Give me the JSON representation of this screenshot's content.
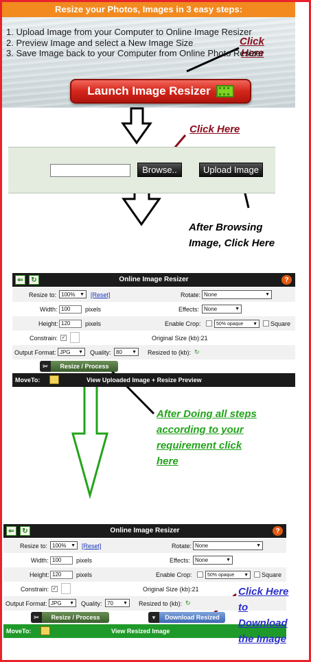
{
  "banner": {
    "title": "Resize your Photos, Images in 3 easy steps:",
    "steps": [
      "1.  Upload Image from your Computer to Online Image Resizer",
      "2.  Preview Image and select a New Image Size",
      "3.  Save Image back to your Computer from Online Photo Resizer"
    ],
    "launch_label": "Launch Image Resizer",
    "click_here_lines": [
      "Click",
      "Here"
    ]
  },
  "annotations": {
    "click_here": "Click Here",
    "after_browsing": [
      "After Browsing",
      "Image, Click Here"
    ],
    "after_steps": [
      "After Doing all steps",
      "according to your",
      "requirement click",
      "here"
    ],
    "download_lines": [
      "Click Here",
      "to",
      "Download",
      "the Image"
    ]
  },
  "upload": {
    "file_value": "",
    "browse_label": "Browse..",
    "upload_label": "Upload Image"
  },
  "panel1": {
    "title": "Online Image Resizer",
    "resize_to_label": "Resize to:",
    "resize_to_value": "100%",
    "reset_label": "[Reset]",
    "rotate_label": "Rotate:",
    "rotate_value": "None",
    "width_label": "Width:",
    "width_value": "100",
    "width_unit": "pixels",
    "effects_label": "Effects:",
    "effects_value": "None",
    "height_label": "Height:",
    "height_value": "120",
    "height_unit": "pixels",
    "crop_label": "Enable Crop:",
    "crop_opacity": "50% opaque",
    "square_label": "Square",
    "constrain_label": "Constrain:",
    "original_size": "Original Size (kb):21",
    "format_label": "Output Format:",
    "format_value": "JPG",
    "quality_label": "Quality:",
    "quality_value": "80",
    "resized_label": "Resized to (kb):",
    "process_label": "Resize / Process",
    "moveto_label": "MoveTo:",
    "moveto_text": "View Uploaded Image + Resize Preview"
  },
  "panel2": {
    "title": "Online Image Resizer",
    "resize_to_label": "Resize to:",
    "resize_to_value": "100%",
    "reset_label": "[Reset]",
    "rotate_label": "Rotate:",
    "rotate_value": "None",
    "width_label": "Width:",
    "width_value": "100",
    "width_unit": "pixels",
    "effects_label": "Effects:",
    "effects_value": "None",
    "height_label": "Height:",
    "height_value": "120",
    "height_unit": "pixels",
    "crop_label": "Enable Crop:",
    "crop_opacity": "50% opaque",
    "square_label": "Square",
    "constrain_label": "Constrain:",
    "original_size": "Original Size (kb):21",
    "format_label": "Output Format:",
    "format_value": "JPG",
    "quality_label": "Quality:",
    "quality_value": "70",
    "resized_label": "Resized to (kb):",
    "process_label": "Resize / Process",
    "download_label": "Download Resized",
    "moveto_label": "MoveTo:",
    "moveto_text": "View Resized Image"
  },
  "colors": {
    "frame": "#e8232b",
    "banner_head": "#f28a1f",
    "annotation_red": "#8b0a1c",
    "annotation_green": "#22a31a",
    "annotation_blue": "#2a2ec8",
    "green_bar": "#1f9a2a",
    "download_blue": "#4a78c4"
  },
  "icons": [
    "back-arrow-icon",
    "refresh-icon",
    "help-icon",
    "image-icon",
    "checkmark-icon",
    "scissors-icon",
    "down-arrow-icon"
  ]
}
